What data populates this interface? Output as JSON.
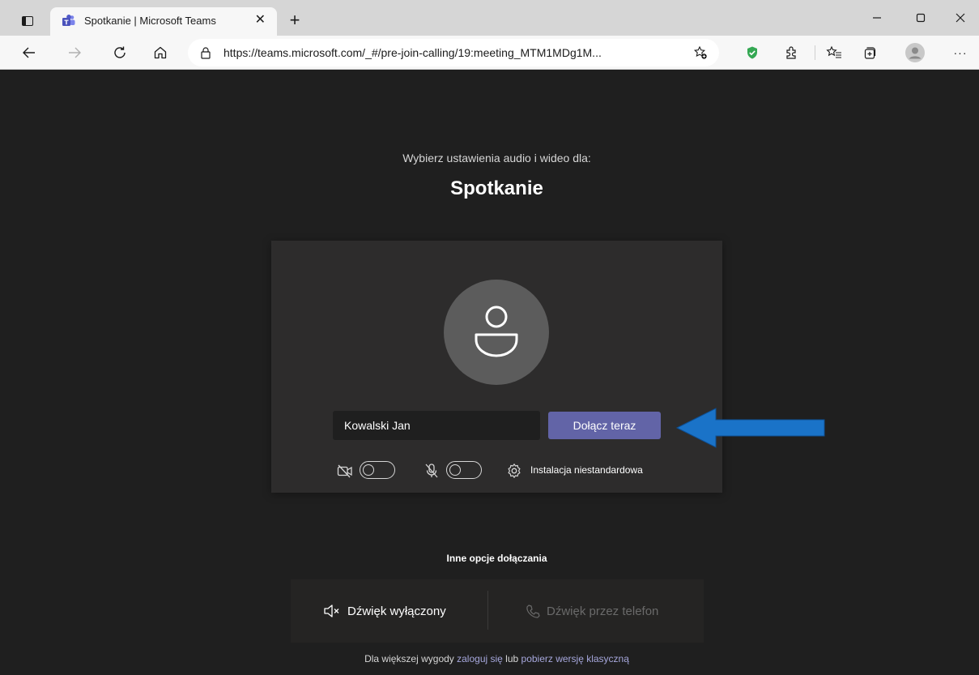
{
  "browser": {
    "tab": {
      "title": "Spotkanie | Microsoft Teams",
      "close_glyph": "✕",
      "favicon": "teams-icon"
    },
    "new_tab_glyph": "+",
    "window_controls": {
      "minimize": "—",
      "maximize": "▢",
      "close": "✕"
    },
    "url": {
      "host": "https://teams.microsoft.com/",
      "path": "_#/pre-join-calling/19:meeting_MTM1MDg1M..."
    },
    "more_glyph": "···"
  },
  "prejoin": {
    "subtitle": "Wybierz ustawienia audio i wideo dla:",
    "meeting_title": "Spotkanie",
    "name_value": "Kowalski Jan",
    "join_label": "Dołącz teraz",
    "custom_setup_label": "Instalacja niestandardowa",
    "camera_toggle": "off",
    "mic_toggle": "off"
  },
  "other_options": {
    "title": "Inne opcje dołączania",
    "audio_off_label": "Dźwięk wyłączony",
    "phone_audio_label": "Dźwięk przez telefon"
  },
  "footer": {
    "prefix": "Dla większej wygody ",
    "sign_in_link": "zaloguj się",
    "middle": " lub ",
    "download_link": "pobierz wersję klasyczną"
  },
  "colors": {
    "accent": "#6264a7",
    "page_background": "#1f1f1f",
    "card_background": "#2d2c2c",
    "arrow": "#1a73c8"
  }
}
